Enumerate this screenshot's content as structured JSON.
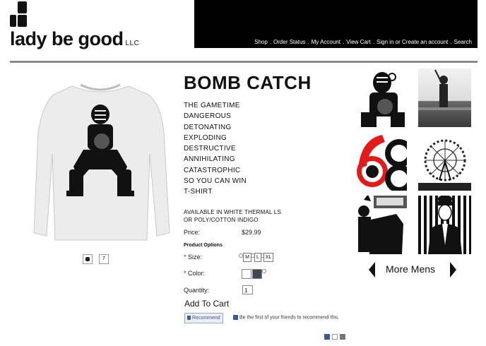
{
  "brand": {
    "name": "lady be good",
    "suffix": "LLC"
  },
  "nav": {
    "items": [
      "Shop",
      "Order Status",
      "My Account",
      "View Cart",
      "Sign in or Create an account",
      "Search"
    ],
    "separator": "."
  },
  "product": {
    "title": "BOMB CATCH",
    "description_lines": [
      "THE GAMETIME",
      "DANGEROUS",
      "DETONATING",
      "EXPLODING",
      "DESTRUCTIVE",
      "ANNIHILATING",
      "CATASTROPHIC",
      "SO YOU CAN WIN",
      "T-SHIRT"
    ],
    "availability_lines": [
      "AVAILABLE IN WHITE THERMAL LS",
      "OR POLY/COTTON INDIGO"
    ],
    "price_label": "Price:",
    "price": "$29.99",
    "options_heading": "Product Options",
    "size_label": "Size:",
    "sizes": [
      "M",
      "L",
      "XL"
    ],
    "color_label": "Color:",
    "colors": [
      "#ffffff",
      "#3f4852"
    ],
    "quantity_label": "Quantity:",
    "quantity_value": "1",
    "add_to_cart": "Add To Cart",
    "required_mark": "*"
  },
  "social": {
    "recommend_label": "Recommend",
    "recommend_text": "Be the first of your friends to recommend this."
  },
  "thumbnails": {
    "second_label": "7"
  },
  "more": {
    "label": "More Mens"
  },
  "colors": {
    "topbar": "#000000",
    "rule": "#8a8a8a",
    "required": "#cc0000",
    "facebook": "#3b5998"
  }
}
